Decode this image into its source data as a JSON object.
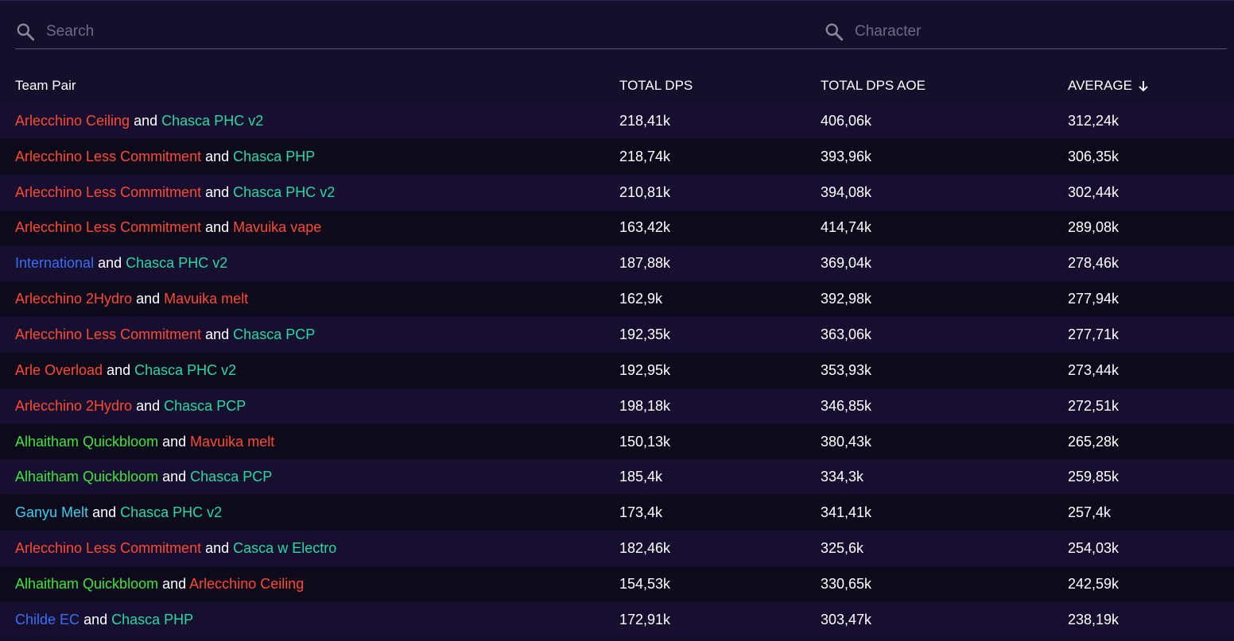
{
  "search": {
    "team_placeholder": "Search",
    "character_placeholder": "Character"
  },
  "colors": {
    "pyro": "#ff4a33",
    "anemo": "#29d9a2",
    "hydro": "#3a6ef5",
    "dendro": "#3ee63a",
    "cryo": "#3ad0ec",
    "connector": "#ffffff",
    "placeholder": "#6e6a84"
  },
  "table": {
    "headers": {
      "team_pair": "Team Pair",
      "total_dps": "TOTAL DPS",
      "total_dps_aoe": "TOTAL DPS AOE",
      "average": "AVERAGE"
    },
    "sort": {
      "column": "average",
      "direction": "descending",
      "icon": "arrow-down-icon"
    },
    "rows": [
      {
        "team1": "Arlecchino Ceiling",
        "team1_color": "pyro",
        "connector": "and",
        "team2": "Chasca PHC v2",
        "team2_color": "anemo",
        "total_dps": "218,41k",
        "total_dps_aoe": "406,06k",
        "average": "312,24k"
      },
      {
        "team1": "Arlecchino Less Commitment",
        "team1_color": "pyro",
        "connector": "and",
        "team2": "Chasca PHP",
        "team2_color": "anemo",
        "total_dps": "218,74k",
        "total_dps_aoe": "393,96k",
        "average": "306,35k"
      },
      {
        "team1": "Arlecchino Less Commitment",
        "team1_color": "pyro",
        "connector": "and",
        "team2": "Chasca PHC v2",
        "team2_color": "anemo",
        "total_dps": "210,81k",
        "total_dps_aoe": "394,08k",
        "average": "302,44k"
      },
      {
        "team1": "Arlecchino Less Commitment",
        "team1_color": "pyro",
        "connector": "and",
        "team2": "Mavuika vape",
        "team2_color": "pyro",
        "total_dps": "163,42k",
        "total_dps_aoe": "414,74k",
        "average": "289,08k"
      },
      {
        "team1": "International",
        "team1_color": "hydro",
        "connector": "and",
        "team2": "Chasca PHC v2",
        "team2_color": "anemo",
        "total_dps": "187,88k",
        "total_dps_aoe": "369,04k",
        "average": "278,46k"
      },
      {
        "team1": "Arlecchino 2Hydro",
        "team1_color": "pyro",
        "connector": "and",
        "team2": "Mavuika melt",
        "team2_color": "pyro",
        "total_dps": "162,9k",
        "total_dps_aoe": "392,98k",
        "average": "277,94k"
      },
      {
        "team1": "Arlecchino Less Commitment",
        "team1_color": "pyro",
        "connector": "and",
        "team2": "Chasca PCP",
        "team2_color": "anemo",
        "total_dps": "192,35k",
        "total_dps_aoe": "363,06k",
        "average": "277,71k"
      },
      {
        "team1": "Arle Overload",
        "team1_color": "pyro",
        "connector": "and",
        "team2": "Chasca PHC v2",
        "team2_color": "anemo",
        "total_dps": "192,95k",
        "total_dps_aoe": "353,93k",
        "average": "273,44k"
      },
      {
        "team1": "Arlecchino 2Hydro",
        "team1_color": "pyro",
        "connector": "and",
        "team2": "Chasca PCP",
        "team2_color": "anemo",
        "total_dps": "198,18k",
        "total_dps_aoe": "346,85k",
        "average": "272,51k"
      },
      {
        "team1": "Alhaitham Quickbloom",
        "team1_color": "dendro",
        "connector": "and",
        "team2": "Mavuika melt",
        "team2_color": "pyro",
        "total_dps": "150,13k",
        "total_dps_aoe": "380,43k",
        "average": "265,28k"
      },
      {
        "team1": "Alhaitham Quickbloom",
        "team1_color": "dendro",
        "connector": "and",
        "team2": "Chasca PCP",
        "team2_color": "anemo",
        "total_dps": "185,4k",
        "total_dps_aoe": "334,3k",
        "average": "259,85k"
      },
      {
        "team1": "Ganyu Melt",
        "team1_color": "cryo",
        "connector": "and",
        "team2": "Chasca PHC v2",
        "team2_color": "anemo",
        "total_dps": "173,4k",
        "total_dps_aoe": "341,41k",
        "average": "257,4k"
      },
      {
        "team1": "Arlecchino Less Commitment",
        "team1_color": "pyro",
        "connector": "and",
        "team2": "Casca w Electro",
        "team2_color": "anemo",
        "total_dps": "182,46k",
        "total_dps_aoe": "325,6k",
        "average": "254,03k"
      },
      {
        "team1": "Alhaitham Quickbloom",
        "team1_color": "dendro",
        "connector": "and",
        "team2": "Arlecchino Ceiling",
        "team2_color": "pyro",
        "total_dps": "154,53k",
        "total_dps_aoe": "330,65k",
        "average": "242,59k"
      },
      {
        "team1": "Childe EC",
        "team1_color": "hydro",
        "connector": "and",
        "team2": "Chasca PHP",
        "team2_color": "anemo",
        "total_dps": "172,91k",
        "total_dps_aoe": "303,47k",
        "average": "238,19k"
      }
    ]
  }
}
